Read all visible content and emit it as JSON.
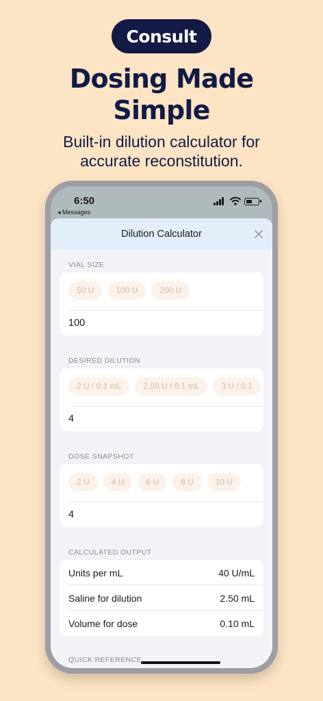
{
  "badge": "Consult",
  "headline_line1": "Dosing Made",
  "headline_line2": "Simple",
  "subhead_line1": "Built-in dilution calculator for",
  "subhead_line2": "accurate reconstitution.",
  "status": {
    "time": "6:50",
    "back": "◂ Messages"
  },
  "sheet": {
    "title": "Dilution Calculator"
  },
  "vial": {
    "label": "VIAL SIZE",
    "options": [
      "50 U",
      "100 U",
      "200 U"
    ],
    "value": "100"
  },
  "dilution": {
    "label": "DESIRED DILUTION",
    "options": [
      "2 U / 0.1 mL",
      "2.50 U / 0.1 mL",
      "3 U / 0.1"
    ],
    "value": "4"
  },
  "dose": {
    "label": "DOSE SNAPSHOT",
    "options": [
      "2 U",
      "4 U",
      "6 U",
      "8 U",
      "10 U"
    ],
    "value": "4"
  },
  "output": {
    "label": "CALCULATED OUTPUT",
    "rows": [
      {
        "label": "Units per mL",
        "value": "40 U/mL"
      },
      {
        "label": "Saline for dilution",
        "value": "2.50 mL"
      },
      {
        "label": "Volume for dose",
        "value": "0.10 mL"
      }
    ]
  },
  "quick_reference": {
    "label": "QUICK REFERENCE"
  },
  "colors": {
    "navy": "#121a45",
    "background": "#fde4c4",
    "chip_bg": "#fbf2ea",
    "chip_text": "#d9b89e"
  }
}
